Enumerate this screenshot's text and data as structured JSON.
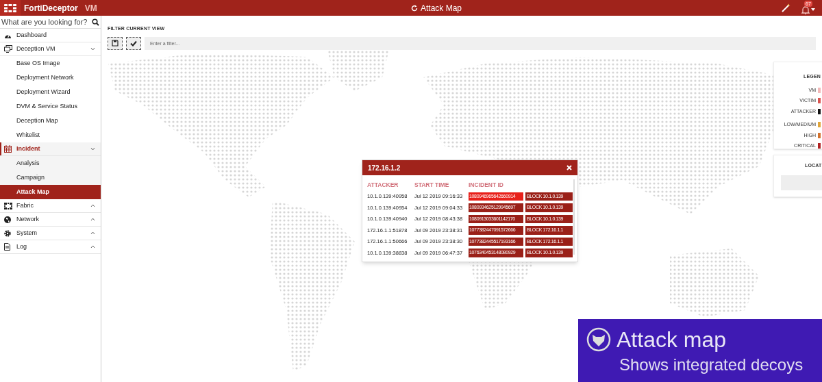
{
  "header": {
    "brand": "FortiDeceptor",
    "edition": "VM",
    "title": "Attack Map",
    "notification_count": "67"
  },
  "sidebar": {
    "search_placeholder": "What are you looking for?",
    "items": [
      {
        "label": "Dashboard",
        "selected": false
      },
      {
        "label": "Deception VM",
        "expanded": true,
        "selected": false,
        "children": [
          {
            "label": "Base OS Image",
            "selected": false
          },
          {
            "label": "Deployment Network",
            "selected": false
          },
          {
            "label": "Deployment Wizard",
            "selected": false
          },
          {
            "label": "DVM & Service Status",
            "selected": false
          },
          {
            "label": "Deception Map",
            "selected": false
          },
          {
            "label": "Whitelist",
            "selected": false
          }
        ]
      },
      {
        "label": "Incident",
        "expanded": true,
        "selected": true,
        "children": [
          {
            "label": "Analysis",
            "selected": false
          },
          {
            "label": "Campaign",
            "selected": false
          },
          {
            "label": "Attack Map",
            "selected": true
          }
        ]
      },
      {
        "label": "Fabric",
        "expanded": false,
        "selected": false
      },
      {
        "label": "Network",
        "expanded": false,
        "selected": false
      },
      {
        "label": "System",
        "expanded": false,
        "selected": false
      },
      {
        "label": "Log",
        "expanded": false,
        "selected": false
      }
    ]
  },
  "filter": {
    "title": "FILTER CURRENT VIEW",
    "placeholder": "Enter a filter..."
  },
  "popup": {
    "title": "172.16.1.2",
    "columns": [
      "ATTACKER",
      "START TIME",
      "INCIDENT ID"
    ],
    "rows": [
      {
        "attacker": "10.1.0.139:40958",
        "start_time": "Jul 12 2019 09:16:33",
        "incident_id": "1080946965642660914",
        "block": "BLOCK 10.1.0.139",
        "highlighted": true
      },
      {
        "attacker": "10.1.0.139:40954",
        "start_time": "Jul 12 2019 09:04:33",
        "incident_id": "1080934625129945697",
        "block": "BLOCK 10.1.0.139",
        "highlighted": false
      },
      {
        "attacker": "10.1.0.139:40940",
        "start_time": "Jul 12 2019 08:43:38",
        "incident_id": "1080913033601142170",
        "block": "BLOCK 10.1.0.139",
        "highlighted": false
      },
      {
        "attacker": "172.16.1.1:51878",
        "start_time": "Jul 09 2019 23:38:31",
        "incident_id": "1077382447091572666",
        "block": "BLOCK 172.16.1.1",
        "highlighted": false
      },
      {
        "attacker": "172.16.1.1:50666",
        "start_time": "Jul 09 2019 23:38:30",
        "incident_id": "1077382445517193166",
        "block": "BLOCK 172.16.1.1",
        "highlighted": false
      },
      {
        "attacker": "10.1.0.139:38838",
        "start_time": "Jul 09 2019 06:47:37",
        "incident_id": "1076340453148080929",
        "block": "BLOCK 10.1.0.139",
        "highlighted": false
      }
    ]
  },
  "legend": {
    "title": "LEGEN",
    "groups": [
      [
        {
          "label": "VM",
          "color": "#f2b8b8"
        },
        {
          "label": "VICTIM",
          "color": "#d9534f"
        },
        {
          "label": "ATTACKER",
          "color": "#111111"
        }
      ],
      [
        {
          "label": "LOW/MEDIUM",
          "color": "#e0a63a"
        },
        {
          "label": "HIGH",
          "color": "#d2722e"
        },
        {
          "label": "CRITICAL",
          "color": "#b02222"
        }
      ]
    ]
  },
  "location": {
    "title": "LOCAT"
  },
  "caption": {
    "title": "Attack map",
    "subtitle": "Shows integrated decoys"
  }
}
